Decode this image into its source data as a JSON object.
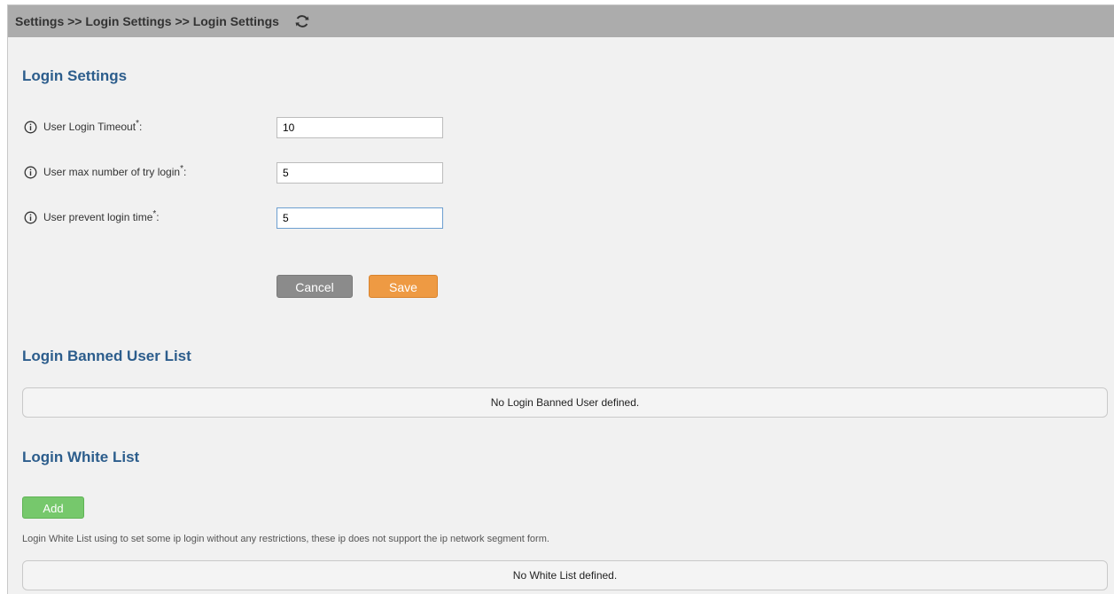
{
  "breadcrumb": "Settings >> Login Settings >> Login Settings",
  "icons": {
    "refresh": "refresh-icon",
    "info": "info-icon"
  },
  "login_settings": {
    "title": "Login Settings",
    "fields": [
      {
        "label": "User Login Timeout",
        "required_mark": "*",
        "suffix": ":",
        "value": "10"
      },
      {
        "label": "User max number of try login",
        "required_mark": "*",
        "suffix": ":",
        "value": "5"
      },
      {
        "label": "User prevent login time",
        "required_mark": "*",
        "suffix": ":",
        "value": "5"
      }
    ],
    "cancel_label": "Cancel",
    "save_label": "Save"
  },
  "banned_list": {
    "title": "Login Banned User List",
    "empty_text": "No Login Banned User defined."
  },
  "white_list": {
    "title": "Login White List",
    "add_label": "Add",
    "note": "Login White List using to set some ip login without any restrictions,  these ip does not support the ip network segment form.",
    "empty_text": "No White List defined."
  },
  "colors": {
    "breadcrumb_bar": "#acacac",
    "section_title": "#2c5d8c",
    "cancel_button": "#8b8b8b",
    "save_button": "#ee9a43",
    "add_button": "#76c86c",
    "page_background": "#f1f1f1"
  }
}
